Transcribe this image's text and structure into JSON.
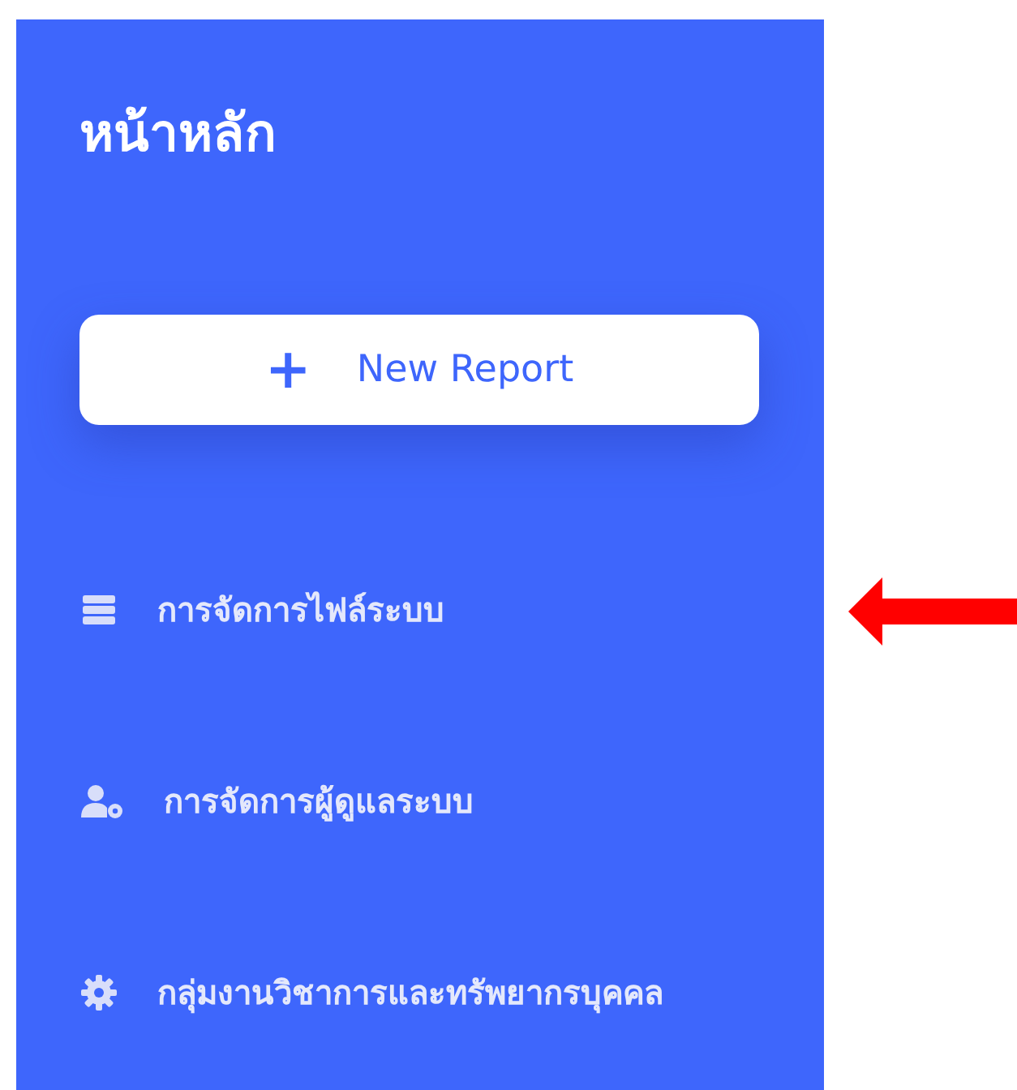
{
  "sidebar": {
    "title": "หน้าหลัก",
    "new_button": {
      "icon": "+",
      "label": "New Report"
    },
    "items": [
      {
        "kind": "database",
        "label": "การจัดการไฟล์ระบบ"
      },
      {
        "kind": "user-gear",
        "label": "การจัดการผู้ดูแลระบบ"
      },
      {
        "kind": "gear",
        "label": "กลุ่มงานวิชาการและทรัพยากรบุคคล"
      }
    ]
  }
}
